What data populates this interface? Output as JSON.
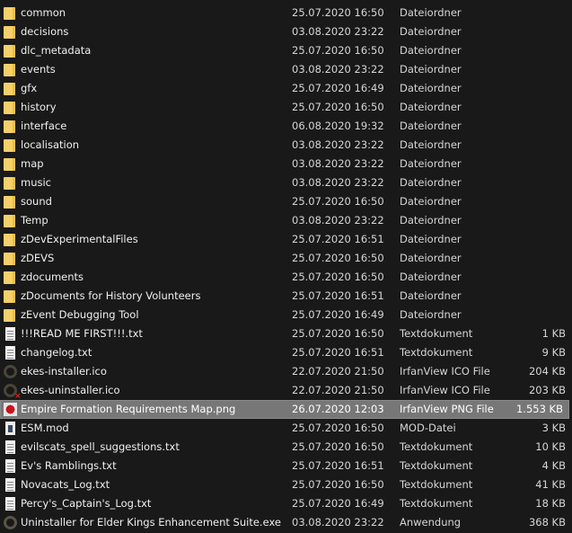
{
  "files": [
    {
      "name": "common",
      "date": "25.07.2020 16:50",
      "type": "Dateiordner",
      "size": "",
      "icon": "folder-icon"
    },
    {
      "name": "decisions",
      "date": "03.08.2020 23:22",
      "type": "Dateiordner",
      "size": "",
      "icon": "folder-icon"
    },
    {
      "name": "dlc_metadata",
      "date": "25.07.2020 16:50",
      "type": "Dateiordner",
      "size": "",
      "icon": "folder-icon"
    },
    {
      "name": "events",
      "date": "03.08.2020 23:22",
      "type": "Dateiordner",
      "size": "",
      "icon": "folder-icon"
    },
    {
      "name": "gfx",
      "date": "25.07.2020 16:49",
      "type": "Dateiordner",
      "size": "",
      "icon": "folder-icon"
    },
    {
      "name": "history",
      "date": "25.07.2020 16:50",
      "type": "Dateiordner",
      "size": "",
      "icon": "folder-icon"
    },
    {
      "name": "interface",
      "date": "06.08.2020 19:32",
      "type": "Dateiordner",
      "size": "",
      "icon": "folder-icon"
    },
    {
      "name": "localisation",
      "date": "03.08.2020 23:22",
      "type": "Dateiordner",
      "size": "",
      "icon": "folder-icon"
    },
    {
      "name": "map",
      "date": "03.08.2020 23:22",
      "type": "Dateiordner",
      "size": "",
      "icon": "folder-icon"
    },
    {
      "name": "music",
      "date": "03.08.2020 23:22",
      "type": "Dateiordner",
      "size": "",
      "icon": "folder-icon"
    },
    {
      "name": "sound",
      "date": "25.07.2020 16:50",
      "type": "Dateiordner",
      "size": "",
      "icon": "folder-icon"
    },
    {
      "name": "Temp",
      "date": "03.08.2020 23:22",
      "type": "Dateiordner",
      "size": "",
      "icon": "folder-icon"
    },
    {
      "name": "zDevExperimentalFiles",
      "date": "25.07.2020 16:51",
      "type": "Dateiordner",
      "size": "",
      "icon": "folder-icon"
    },
    {
      "name": "zDEVS",
      "date": "25.07.2020 16:50",
      "type": "Dateiordner",
      "size": "",
      "icon": "folder-icon"
    },
    {
      "name": "zdocuments",
      "date": "25.07.2020 16:50",
      "type": "Dateiordner",
      "size": "",
      "icon": "folder-icon"
    },
    {
      "name": "zDocuments for History Volunteers",
      "date": "25.07.2020 16:51",
      "type": "Dateiordner",
      "size": "",
      "icon": "folder-icon"
    },
    {
      "name": "zEvent Debugging Tool",
      "date": "25.07.2020 16:49",
      "type": "Dateiordner",
      "size": "",
      "icon": "folder-icon"
    },
    {
      "name": "!!!READ ME FIRST!!!.txt",
      "date": "25.07.2020 16:50",
      "type": "Textdokument",
      "size": "1 KB",
      "icon": "text-file-icon"
    },
    {
      "name": "changelog.txt",
      "date": "25.07.2020 16:51",
      "type": "Textdokument",
      "size": "9 KB",
      "icon": "text-file-icon"
    },
    {
      "name": "ekes-installer.ico",
      "date": "22.07.2020 21:50",
      "type": "IrfanView ICO File",
      "size": "204 KB",
      "icon": "ring-icon"
    },
    {
      "name": "ekes-uninstaller.ico",
      "date": "22.07.2020 21:50",
      "type": "IrfanView ICO File",
      "size": "203 KB",
      "icon": "ring-x-icon"
    },
    {
      "name": "Empire Formation Requirements Map.png",
      "date": "26.07.2020 12:03",
      "type": "IrfanView PNG File",
      "size": "1.553 KB",
      "icon": "png-image-icon",
      "selected": true
    },
    {
      "name": "ESM.mod",
      "date": "25.07.2020 16:50",
      "type": "MOD-Datei",
      "size": "3 KB",
      "icon": "mod-file-icon"
    },
    {
      "name": "evilscats_spell_suggestions.txt",
      "date": "25.07.2020 16:50",
      "type": "Textdokument",
      "size": "10 KB",
      "icon": "text-file-icon"
    },
    {
      "name": "Ev's Ramblings.txt",
      "date": "25.07.2020 16:51",
      "type": "Textdokument",
      "size": "4 KB",
      "icon": "text-file-icon"
    },
    {
      "name": "Novacats_Log.txt",
      "date": "25.07.2020 16:50",
      "type": "Textdokument",
      "size": "41 KB",
      "icon": "text-file-icon"
    },
    {
      "name": "Percy's_Captain's_Log.txt",
      "date": "25.07.2020 16:49",
      "type": "Textdokument",
      "size": "18 KB",
      "icon": "text-file-icon"
    },
    {
      "name": "Uninstaller for Elder Kings Enhancement Suite.exe",
      "date": "03.08.2020 23:22",
      "type": "Anwendung",
      "size": "368 KB",
      "icon": "app-icon"
    }
  ],
  "colors": {
    "background": "#191919",
    "selection": "#777777",
    "folder": "#f5d06a"
  }
}
